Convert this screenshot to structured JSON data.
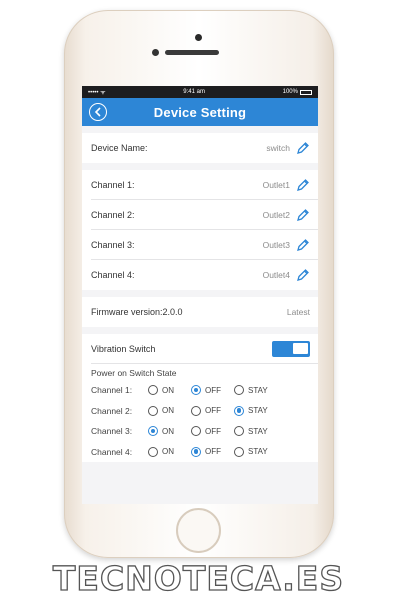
{
  "status_bar": {
    "carrier": "••••• ᯤ",
    "time": "9:41 am",
    "battery": "100%"
  },
  "nav": {
    "title": "Device Setting"
  },
  "device": {
    "label": "Device Name:",
    "value": "switch"
  },
  "channels": [
    {
      "label": "Channel 1:",
      "value": "Outlet1"
    },
    {
      "label": "Channel 2:",
      "value": "Outlet2"
    },
    {
      "label": "Channel 3:",
      "value": "Outlet3"
    },
    {
      "label": "Channel 4:",
      "value": "Outlet4"
    }
  ],
  "firmware": {
    "label": "Firmware version:2.0.0",
    "status": "Latest"
  },
  "vibration": {
    "label": "Vibration Switch",
    "enabled": true
  },
  "power_state": {
    "heading": "Power on Switch State",
    "options": [
      "ON",
      "OFF",
      "STAY"
    ],
    "rows": [
      {
        "label": "Channel 1:",
        "selected": "OFF"
      },
      {
        "label": "Channel 2:",
        "selected": "STAY"
      },
      {
        "label": "Channel 3:",
        "selected": "ON"
      },
      {
        "label": "Channel 4:",
        "selected": "OFF"
      }
    ]
  },
  "colors": {
    "accent": "#2d86d6",
    "status_bar_bg": "#1d1d1f",
    "screen_bg": "#f4f4f6"
  },
  "watermark": "TECNOTECA.ES"
}
